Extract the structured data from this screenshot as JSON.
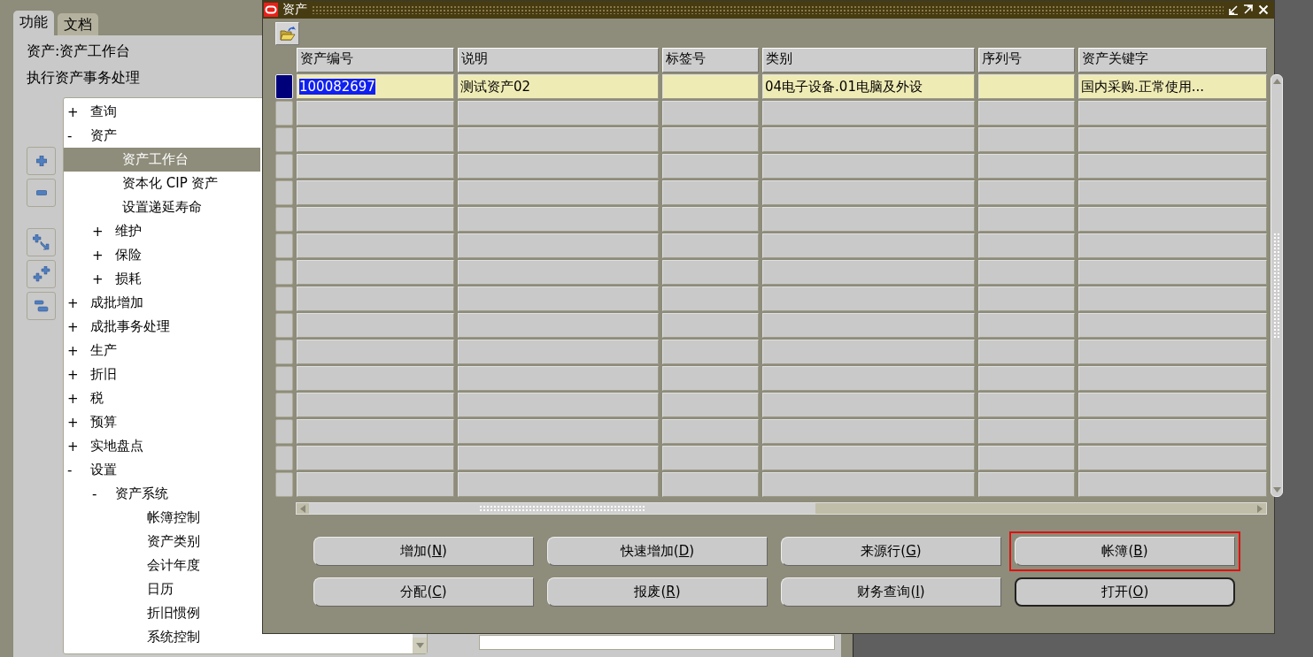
{
  "navigator": {
    "tabs": [
      {
        "label": "功能",
        "selected": true
      },
      {
        "label": "文档",
        "selected": false
      }
    ],
    "function_title": "资产:资产工作台",
    "function_description": "执行资产事务处理",
    "tree": [
      {
        "toggle": "+",
        "label": "查询",
        "selected": false
      },
      {
        "toggle": "-",
        "label": "资产",
        "selected": false,
        "children": [
          {
            "label": "资产工作台",
            "selected": true
          },
          {
            "label": "资本化 CIP 资产",
            "selected": false
          },
          {
            "label": "设置递延寿命",
            "selected": false
          },
          {
            "toggle": "+",
            "label": "维护",
            "selected": false
          },
          {
            "toggle": "+",
            "label": "保险",
            "selected": false
          },
          {
            "toggle": "+",
            "label": "损耗",
            "selected": false
          }
        ]
      },
      {
        "toggle": "+",
        "label": "成批增加",
        "selected": false
      },
      {
        "toggle": "+",
        "label": "成批事务处理",
        "selected": false
      },
      {
        "toggle": "+",
        "label": "生产",
        "selected": false
      },
      {
        "toggle": "+",
        "label": "折旧",
        "selected": false
      },
      {
        "toggle": "+",
        "label": "税",
        "selected": false
      },
      {
        "toggle": "+",
        "label": "预算",
        "selected": false
      },
      {
        "toggle": "+",
        "label": "实地盘点",
        "selected": false
      },
      {
        "toggle": "-",
        "label": "设置",
        "selected": false,
        "children": [
          {
            "toggle": "-",
            "label": "资产系统",
            "selected": false,
            "children": [
              {
                "label": "帐簿控制",
                "selected": false
              },
              {
                "label": "资产类别",
                "selected": false
              },
              {
                "label": "会计年度",
                "selected": false
              },
              {
                "label": "日历",
                "selected": false
              },
              {
                "label": "折旧惯例",
                "selected": false
              },
              {
                "label": "系统控制",
                "selected": false
              }
            ]
          }
        ]
      }
    ]
  },
  "window": {
    "title": "资产",
    "table": {
      "columns": [
        "资产编号",
        "说明",
        "标签号",
        "类别",
        "序列号",
        "资产关键字"
      ],
      "rows": [
        {
          "selected": true,
          "highlighted": true,
          "cells": [
            "100082697",
            "测试资产02",
            null,
            "04电子设备.01电脑及外设",
            null,
            "国内采购.正常使用..."
          ]
        },
        {
          "selected": false
        },
        {
          "selected": false
        },
        {
          "selected": false
        },
        {
          "selected": false
        },
        {
          "selected": false
        },
        {
          "selected": false
        },
        {
          "selected": false
        },
        {
          "selected": false
        },
        {
          "selected": false
        },
        {
          "selected": false
        },
        {
          "selected": false
        },
        {
          "selected": false
        },
        {
          "selected": false
        },
        {
          "selected": false
        },
        {
          "selected": false
        }
      ]
    },
    "buttons": [
      {
        "before": "增加(",
        "mnemonic": "N",
        "after": ")",
        "default": false,
        "highlighted": false
      },
      {
        "before": "快速增加(",
        "mnemonic": "D",
        "after": ")",
        "default": false,
        "highlighted": false
      },
      {
        "before": "来源行(",
        "mnemonic": "G",
        "after": ")",
        "default": false,
        "highlighted": false
      },
      {
        "before": "帐簿(",
        "mnemonic": "B",
        "after": ")",
        "default": false,
        "highlighted": true
      },
      {
        "before": "分配(",
        "mnemonic": "C",
        "after": ")",
        "default": false,
        "highlighted": false
      },
      {
        "before": "报废(",
        "mnemonic": "R",
        "after": ")",
        "default": false,
        "highlighted": false
      },
      {
        "before": "财务查询(",
        "mnemonic": "I",
        "after": ")",
        "default": false,
        "highlighted": false
      },
      {
        "before": "打开(",
        "mnemonic": "O",
        "after": ")",
        "default": true,
        "highlighted": false
      }
    ]
  }
}
